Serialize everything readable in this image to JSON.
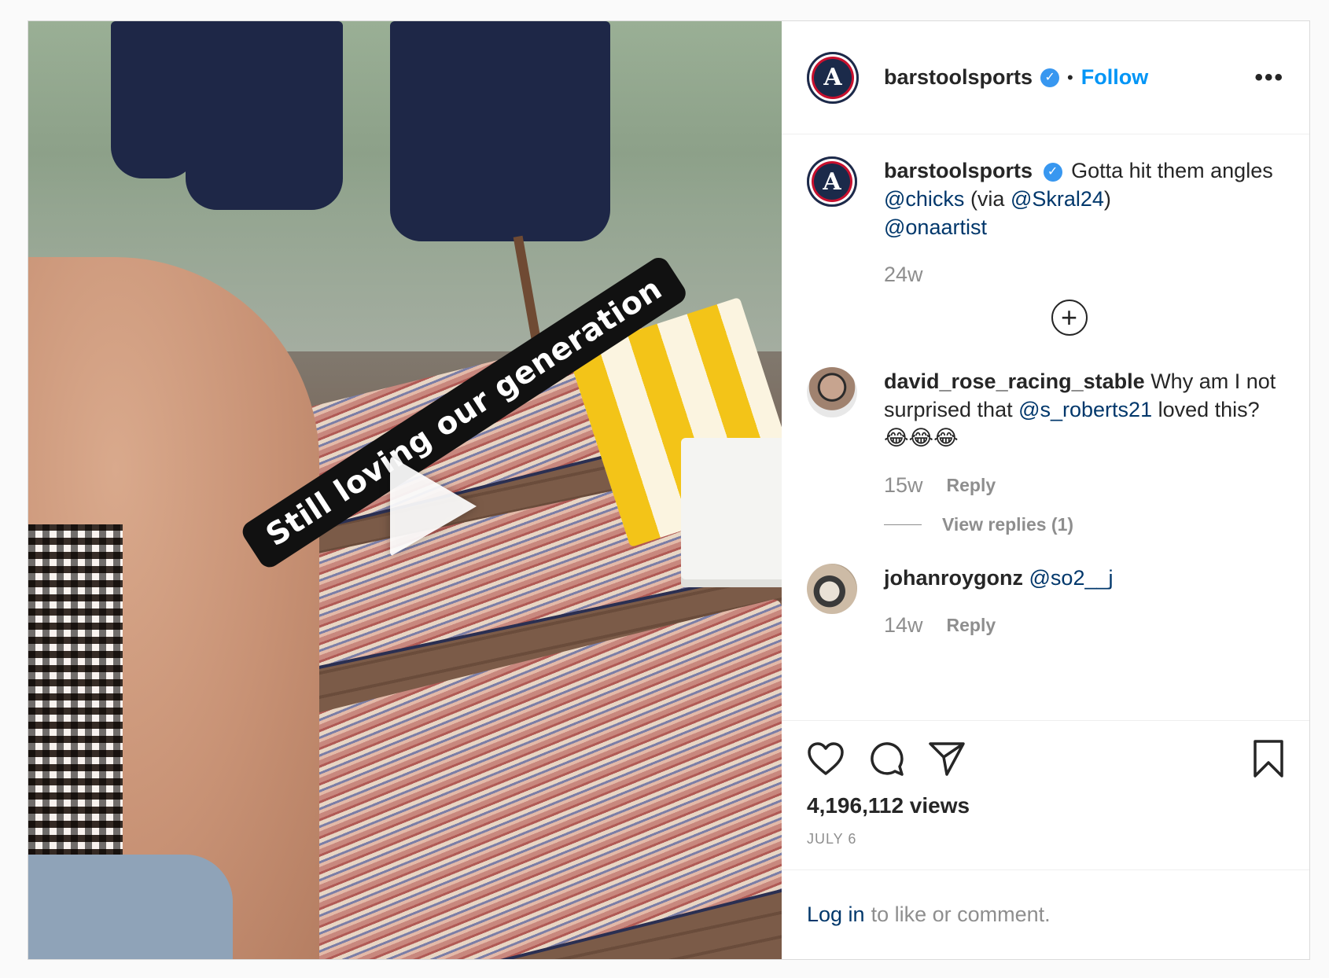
{
  "post": {
    "author": "barstoolsports",
    "verified_icon": "verified-badge-icon",
    "separator": "•",
    "follow_label": "Follow",
    "more_label": "•••",
    "avatar_text": "A",
    "video": {
      "sticker_text": "Still loving our generation",
      "play_icon": "play-icon"
    }
  },
  "caption": {
    "username": "barstoolsports",
    "text_before": "Gotta hit them angles ",
    "mention1": "@chicks",
    "text_middle": " (via ",
    "mention2": "@Skral24",
    "text_after": ")",
    "mention3": "@onaartist",
    "age": "24w"
  },
  "comments": [
    {
      "username": "david_rose_racing_stable",
      "text_before": "Why am I not surprised that ",
      "mention": "@s_roberts21",
      "text_after": " loved this? 😂😂😂",
      "age": "15w",
      "reply_label": "Reply",
      "view_replies_label": "View replies (1)"
    },
    {
      "username": "johanroygonz",
      "mention": "@so2__j",
      "age": "14w",
      "reply_label": "Reply"
    }
  ],
  "stats": {
    "views": "4,196,112 views",
    "date": "JULY 6"
  },
  "login": {
    "link": "Log in",
    "text": "to like or comment."
  },
  "colors": {
    "link_blue": "#0095f6",
    "mention_blue": "#00376b",
    "muted": "#8e8e8e",
    "text": "#262626"
  }
}
